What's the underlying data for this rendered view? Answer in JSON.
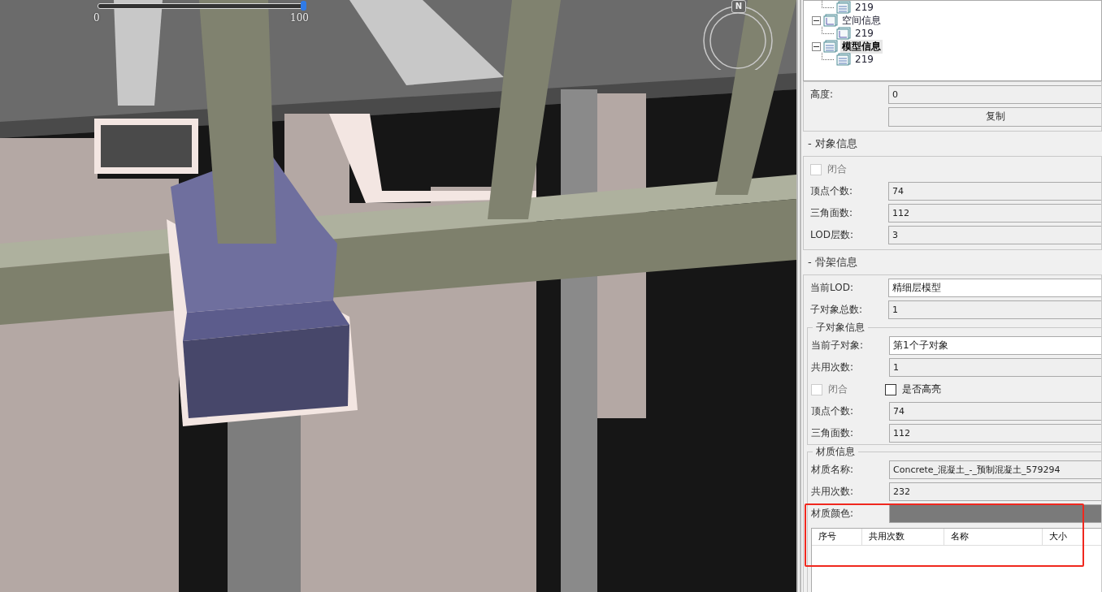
{
  "viewport": {
    "slider": {
      "level": 1.0,
      "min_label": "0",
      "max_label": "100"
    },
    "compass": {
      "label": "N"
    }
  },
  "tree": [
    {
      "children": [
        {
          "label": "219",
          "kind": "table"
        }
      ]
    },
    {
      "label": "空间信息",
      "kind": "axis",
      "expanded": true,
      "selected": false,
      "children": [
        {
          "label": "219",
          "kind": "axis"
        }
      ]
    },
    {
      "label": "模型信息",
      "kind": "table",
      "expanded": true,
      "selected": true,
      "children": [
        {
          "label": "219",
          "kind": "table"
        }
      ]
    }
  ],
  "top_fields": [
    {
      "label": "高度:",
      "value": "0",
      "editable": false
    }
  ],
  "copy_button": "复制",
  "sections": [
    {
      "title": "- 对象信息",
      "rows": [
        {
          "kind": "checkboxes",
          "boxes": [
            {
              "label": "闭合",
              "checked": false,
              "disabled": true
            }
          ]
        },
        {
          "kind": "field",
          "label": "顶点个数:",
          "value": "74",
          "editable": false
        },
        {
          "kind": "field",
          "label": "三角面数:",
          "value": "112",
          "editable": false
        },
        {
          "kind": "field",
          "label": "LOD层数:",
          "value": "3",
          "editable": false
        }
      ]
    },
    {
      "title": "- 骨架信息",
      "rows": [
        {
          "kind": "field",
          "label": "当前LOD:",
          "value": "精细层模型",
          "editable": true
        },
        {
          "kind": "field",
          "label": "子对象总数:",
          "value": "1",
          "editable": false
        }
      ],
      "groups": [
        {
          "title": "子对象信息",
          "rows": [
            {
              "kind": "field",
              "label": "当前子对象:",
              "value": "第1个子对象",
              "editable": true
            },
            {
              "kind": "field",
              "label": "共用次数:",
              "value": "1",
              "editable": false
            },
            {
              "kind": "checkboxes",
              "boxes": [
                {
                  "label": "闭合",
                  "checked": false,
                  "disabled": true
                },
                {
                  "label": "是否高亮",
                  "checked": false,
                  "disabled": false
                }
              ]
            },
            {
              "kind": "field",
              "label": "顶点个数:",
              "value": "74",
              "editable": false
            },
            {
              "kind": "field",
              "label": "三角面数:",
              "value": "112",
              "editable": false
            }
          ]
        },
        {
          "title": "材质信息",
          "rows": [
            {
              "kind": "field",
              "label": "材质名称:",
              "value": "Concrete_混凝土_-_预制混凝土_579294",
              "editable": false
            },
            {
              "kind": "field",
              "label": "共用次数:",
              "value": "232",
              "editable": false
            },
            {
              "kind": "color",
              "label": "材质颜色:",
              "color": "#7a7a7a"
            },
            {
              "kind": "table",
              "columns": [
                "序号",
                "共用次数",
                "名称",
                "大小"
              ]
            }
          ]
        }
      ]
    }
  ]
}
